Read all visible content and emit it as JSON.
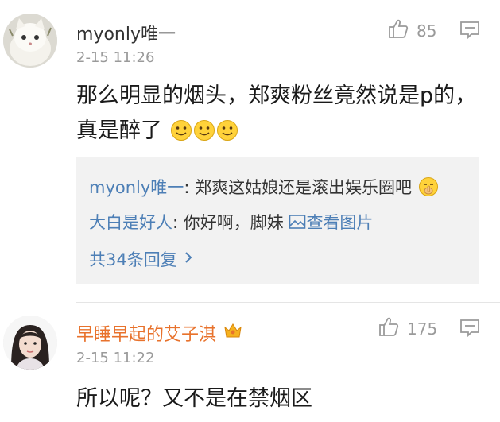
{
  "comments": [
    {
      "username": "myonly唯一",
      "timestamp": "2-15 11:26",
      "like_count": "85",
      "text_line1": "那么明显的烟头，郑爽粉丝竟然说是p的，",
      "text_line2": "真是醉了",
      "replies": [
        {
          "user": "myonly唯一",
          "text": ": 郑爽这姑娘还是滚出娱乐圈吧"
        },
        {
          "user": "大白是好人",
          "text": ": 你好啊，脚妹 ",
          "link": "查看图片"
        }
      ],
      "view_more": "共34条回复"
    },
    {
      "username": "早睡早起的艾子淇",
      "timestamp": "2-15 11:22",
      "like_count": "175",
      "text_line1": "所以呢？又不是在禁烟区"
    }
  ],
  "colors": {
    "link_blue": "#4d7fb6",
    "username_orange": "#e8722c",
    "muted_gray": "#9a9a9a",
    "reply_bg": "#f2f2f2"
  },
  "icons": [
    "thumbs-up-icon",
    "comment-icon",
    "smiley-icon",
    "image-icon",
    "chevron-right-icon",
    "crown-badge-icon",
    "shush-emoji-icon"
  ]
}
